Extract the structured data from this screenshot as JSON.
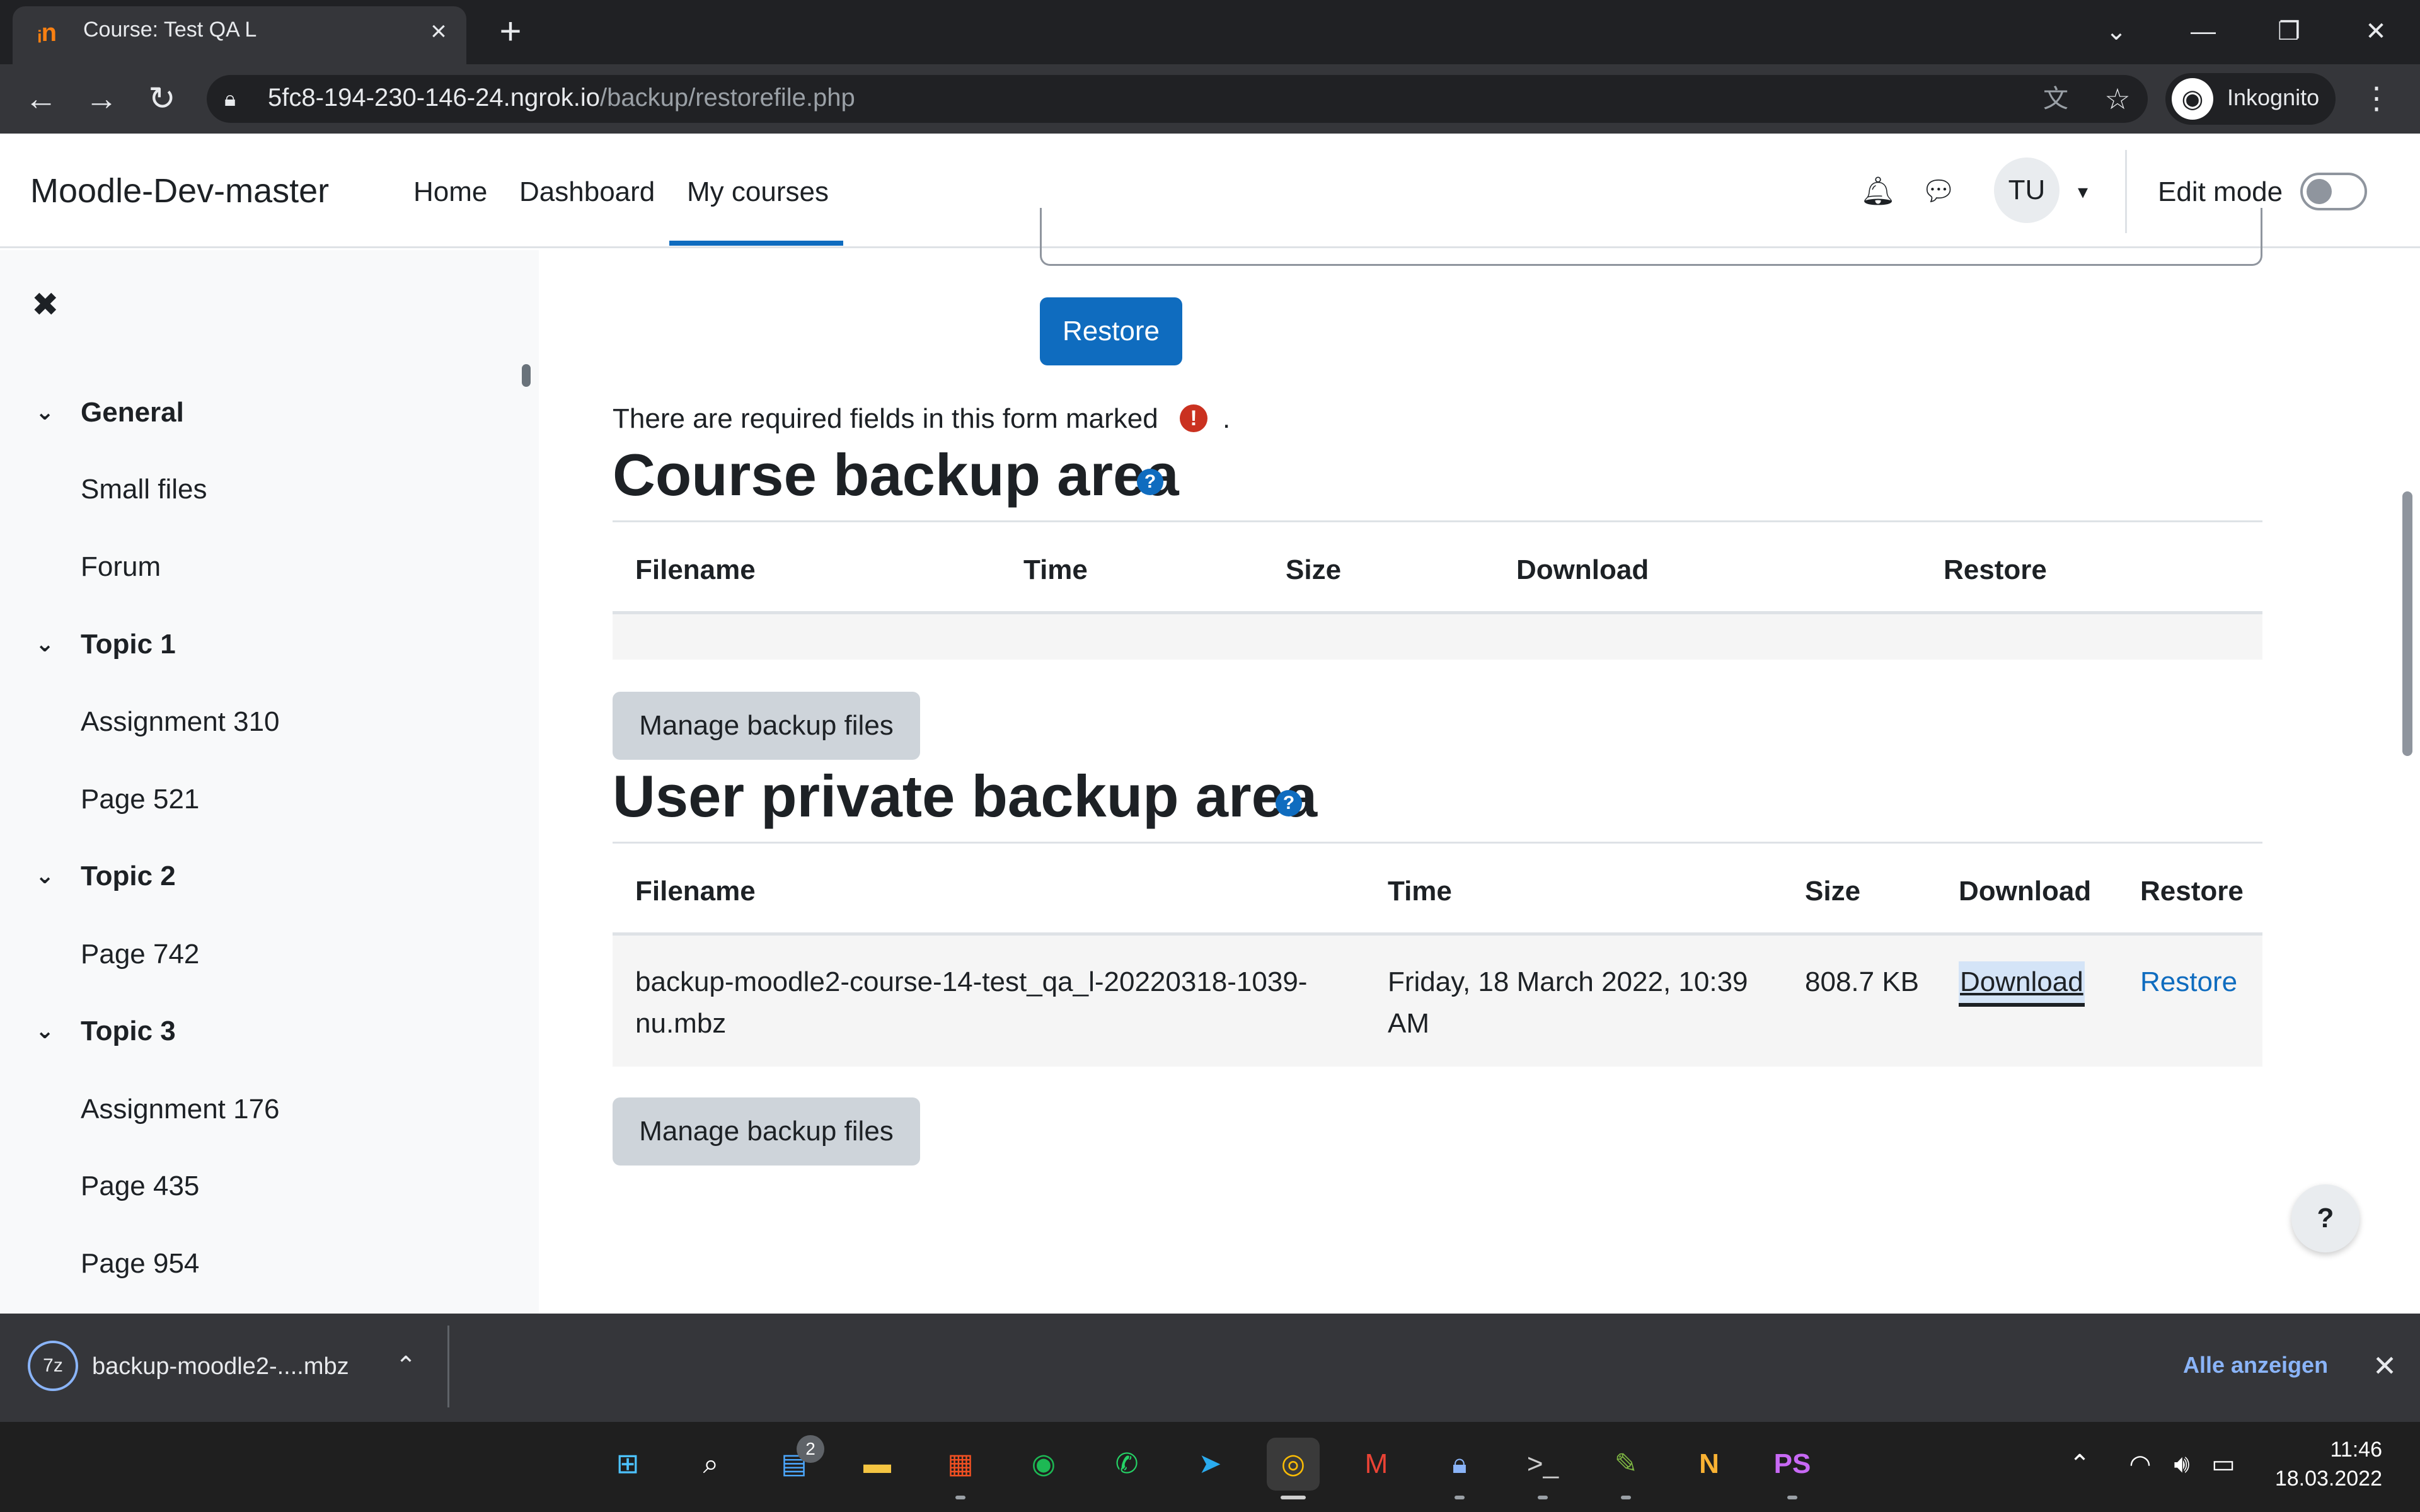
{
  "browser": {
    "tab_title": "Course: Test QA L",
    "tab_favicon": "moodle-m-icon",
    "url_host": "5fc8-194-230-146-24.ngrok.io",
    "url_path": "/backup/restorefile.php",
    "profile_label": "Inkognito"
  },
  "navbar": {
    "site_name": "Moodle-Dev-master",
    "links": [
      "Home",
      "Dashboard",
      "My courses"
    ],
    "active_link": "My courses",
    "avatar_initials": "TU",
    "edit_mode_label": "Edit mode"
  },
  "drawer": {
    "sections": [
      {
        "title": "General",
        "items": [
          "Small files",
          "Forum"
        ]
      },
      {
        "title": "Topic 1",
        "items": [
          "Assignment 310",
          "Page 521"
        ]
      },
      {
        "title": "Topic 2",
        "items": [
          "Page 742"
        ]
      },
      {
        "title": "Topic 3",
        "items": [
          "Assignment 176",
          "Page 435",
          "Page 954"
        ]
      }
    ]
  },
  "main": {
    "restore_button": "Restore",
    "required_note": "There are required fields in this form marked",
    "required_dot": ".",
    "course_backup": {
      "heading": "Course backup area",
      "columns": [
        "Filename",
        "Time",
        "Size",
        "Download",
        "Restore"
      ],
      "rows": [],
      "manage_button": "Manage backup files"
    },
    "user_backup": {
      "heading": "User private backup area",
      "columns": [
        "Filename",
        "Time",
        "Size",
        "Download",
        "Restore"
      ],
      "rows": [
        {
          "filename_line1": "backup-moodle2-course-14-test_qa_l-20220318-1039-",
          "filename_line2": "nu.mbz",
          "time_line1": "Friday, 18 March 2022, 10:39",
          "time_line2": "AM",
          "size": "808.7 KB",
          "download": "Download",
          "restore": "Restore"
        }
      ],
      "manage_button": "Manage backup files"
    },
    "help_fab": "?"
  },
  "download_bar": {
    "filename": "backup-moodle2-....mbz",
    "show_all": "Alle anzeigen"
  },
  "taskbar": {
    "notification_badge": "2",
    "time": "11:46",
    "date": "18.03.2022"
  },
  "colors": {
    "primary": "#0f6cbf",
    "required": "#ca3120",
    "link": "#0f6cbf"
  }
}
